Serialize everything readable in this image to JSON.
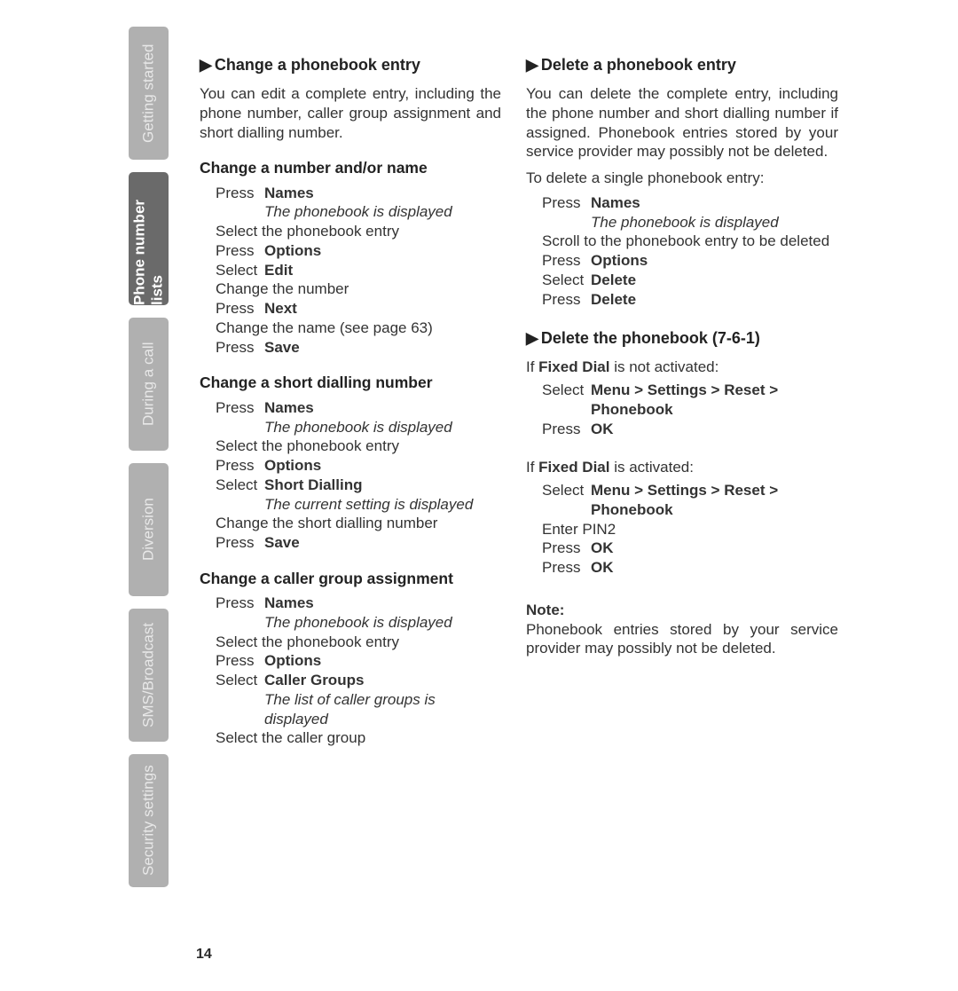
{
  "sidebar": {
    "tabs": [
      {
        "label": "Getting started",
        "active": false
      },
      {
        "label": "Phone number lists",
        "active": true
      },
      {
        "label": "During a call",
        "active": false
      },
      {
        "label": "Diversion",
        "active": false
      },
      {
        "label": "SMS/Broadcast",
        "active": false
      },
      {
        "label": "Security settings",
        "active": false
      }
    ]
  },
  "page_number": "14",
  "left": {
    "s1_title": "Change a phonebook entry",
    "s1_intro": "You can edit a complete entry, including the phone number, caller group assignment and short dialling number.",
    "sub1": "Change a number and/or name",
    "sub1_steps": {
      "r1_verb": "Press",
      "r1_target": "Names",
      "r1_note": "The phonebook is displayed",
      "r2": "Select the phonebook entry",
      "r3_verb": "Press",
      "r3_target": "Options",
      "r4_verb": "Select",
      "r4_target": "Edit",
      "r5": "Change the number",
      "r6_verb": "Press",
      "r6_target": "Next",
      "r7": "Change the name (see page 63)",
      "r8_verb": "Press",
      "r8_target": "Save"
    },
    "sub2": "Change a short dialling number",
    "sub2_steps": {
      "r1_verb": "Press",
      "r1_target": "Names",
      "r1_note": "The phonebook is displayed",
      "r2": "Select the phonebook entry",
      "r3_verb": "Press",
      "r3_target": "Options",
      "r4_verb": "Select",
      "r4_target": "Short Dialling",
      "r4_note": "The current setting is displayed",
      "r5": "Change the short dialling number",
      "r6_verb": "Press",
      "r6_target": "Save"
    },
    "sub3": "Change a caller group assignment",
    "sub3_steps": {
      "r1_verb": "Press",
      "r1_target": "Names",
      "r1_note": "The phonebook is displayed",
      "r2": "Select the phonebook entry",
      "r3_verb": "Press",
      "r3_target": "Options",
      "r4_verb": "Select",
      "r4_target": "Caller Groups",
      "r4_note": "The list of caller groups is displayed",
      "r5": "Select the caller group"
    }
  },
  "right": {
    "s1_title": "Delete a phonebook entry",
    "s1_intro": "You can delete the complete entry, including the phone number and short dialling number if assigned. Phonebook entries stored by your service provider may possibly not be deleted.",
    "s1_lead": "To delete a single phonebook entry:",
    "s1_steps": {
      "r1_verb": "Press",
      "r1_target": "Names",
      "r1_note": "The phonebook is displayed",
      "r2": "Scroll to the phonebook entry to be deleted",
      "r3_verb": "Press",
      "r3_target": "Options",
      "r4_verb": "Select",
      "r4_target": "Delete",
      "r5_verb": "Press",
      "r5_target": "Delete"
    },
    "s2_title": "Delete the phonebook (7-6-1)",
    "s2_if1_pre": "If ",
    "s2_if1_bold": "Fixed Dial",
    "s2_if1_post": " is not activated:",
    "s2_if1_steps": {
      "r1_verb": "Select",
      "r1_target": "Menu > Settings > Reset > Phonebook",
      "r2_verb": "Press",
      "r2_target": "OK"
    },
    "s2_if2_pre": "If ",
    "s2_if2_bold": "Fixed Dial",
    "s2_if2_post": " is activated:",
    "s2_if2_steps": {
      "r1_verb": "Select",
      "r1_target": "Menu > Settings > Reset > Phonebook",
      "r2": "Enter PIN2",
      "r3_verb": "Press",
      "r3_target": "OK",
      "r4_verb": "Press",
      "r4_target": "OK"
    },
    "note_title": "Note:",
    "note_body": "Phonebook entries stored by your service provider may possibly not be deleted."
  }
}
